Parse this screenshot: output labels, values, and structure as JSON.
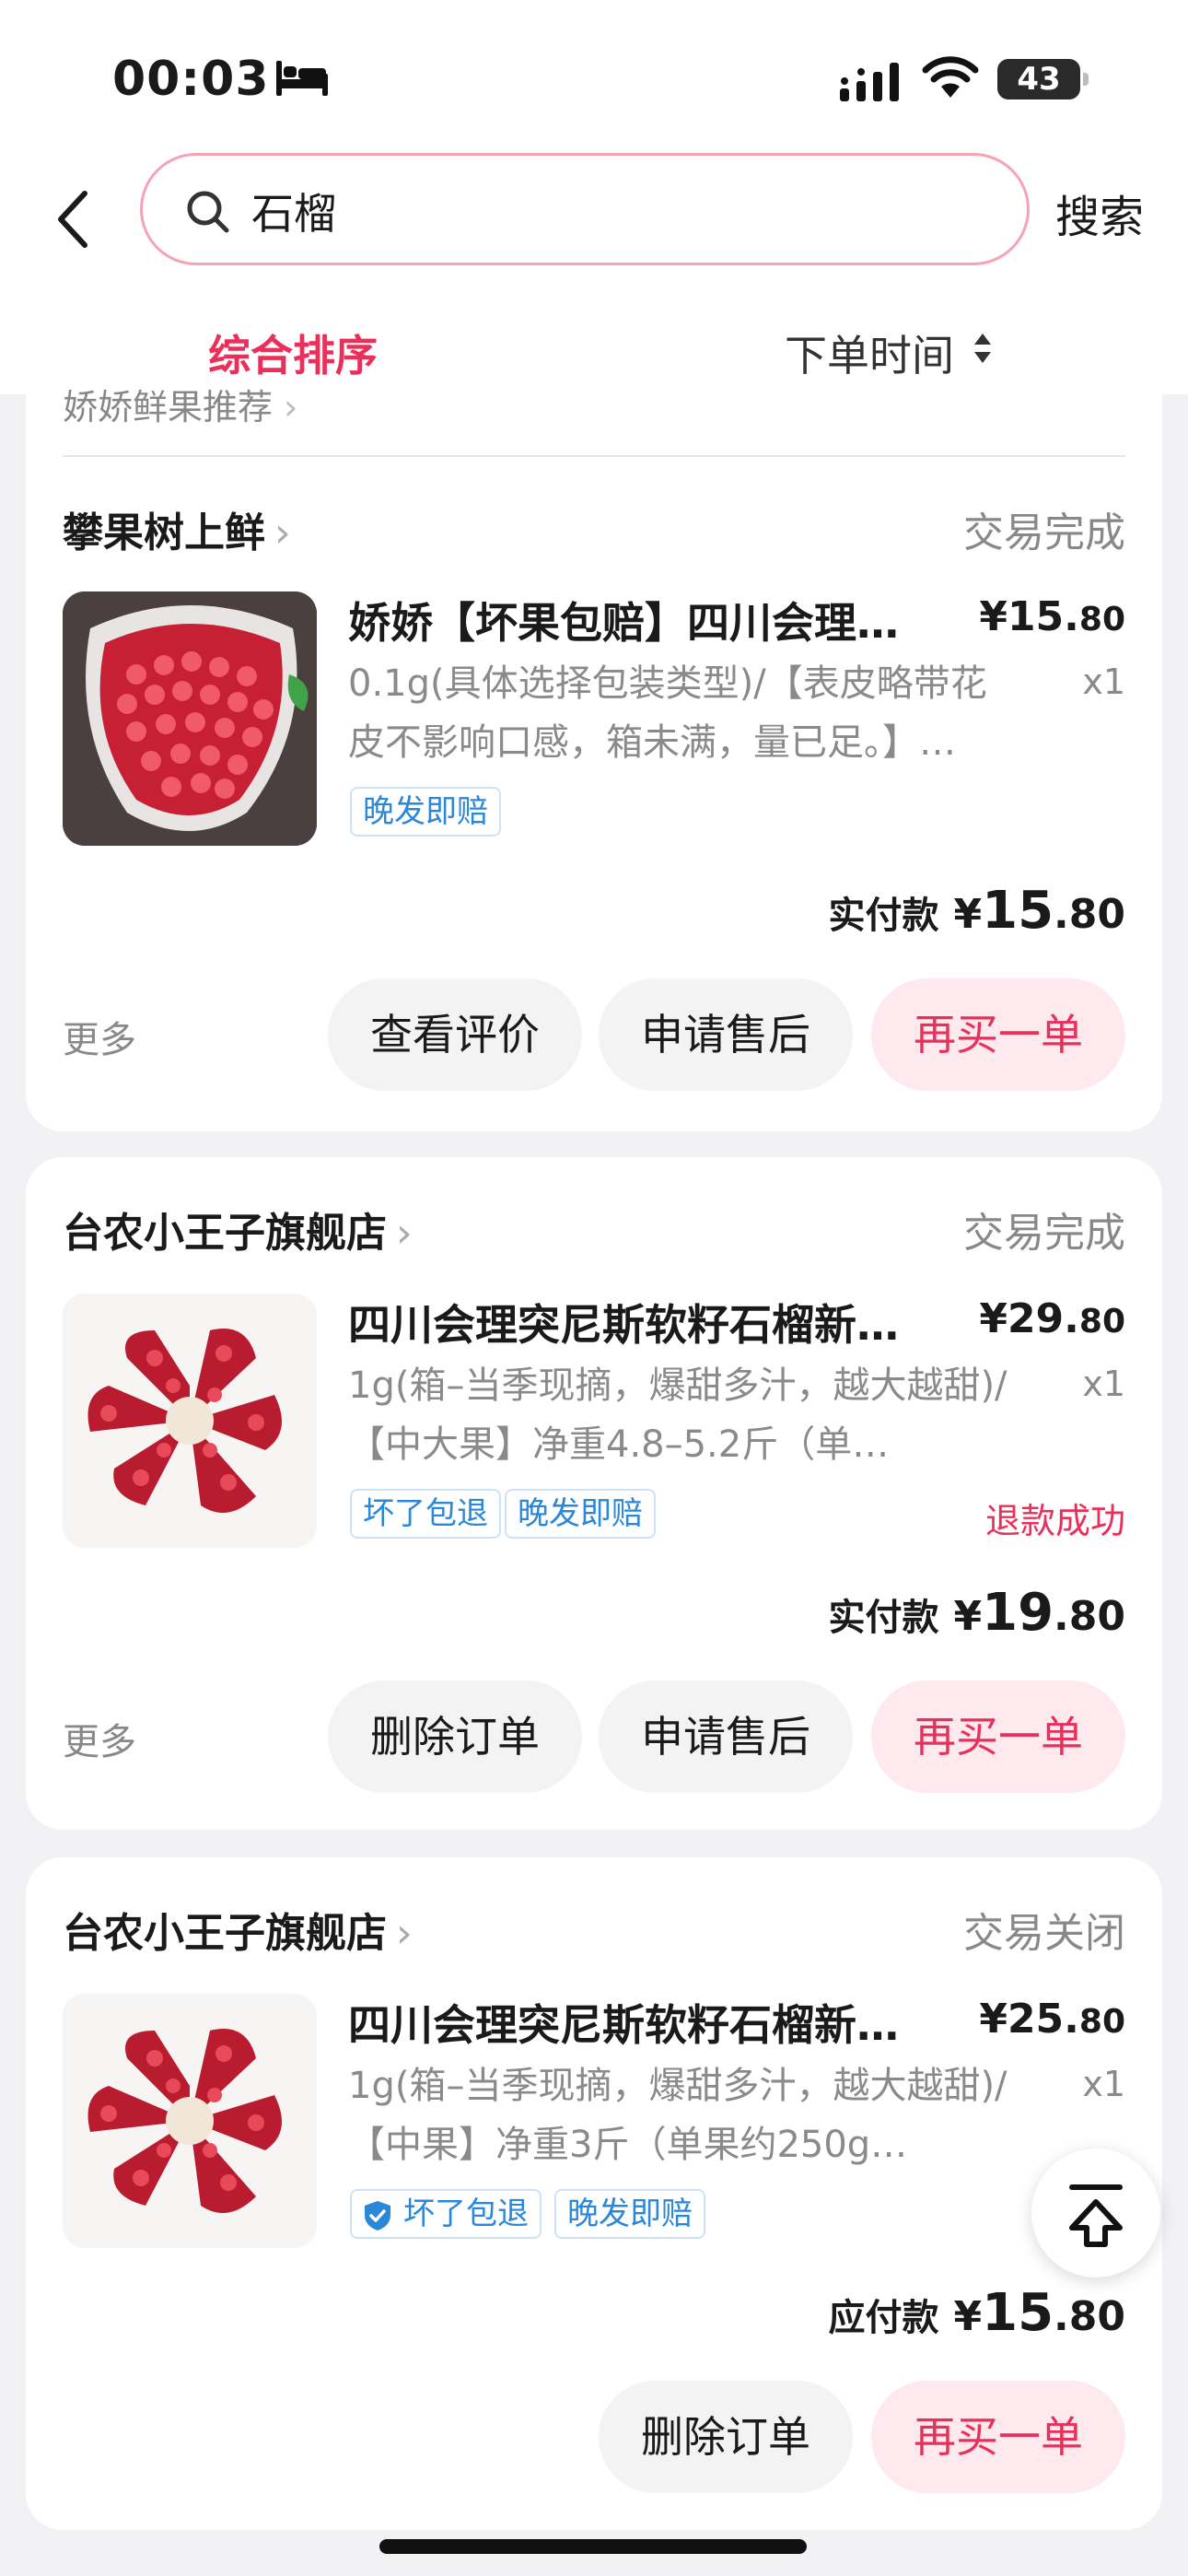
{
  "status_bar": {
    "time": "00:03",
    "battery": "43"
  },
  "search": {
    "value": "石榴",
    "button": "搜索"
  },
  "sort": {
    "primary": "综合排序",
    "secondary": "下单时间"
  },
  "previous_card": {
    "recommend_text": "娇娇鲜果推荐"
  },
  "orders": [
    {
      "shop": "攀果树上鲜",
      "status": "交易完成",
      "title": "娇娇【坏果包赔】四川会理突尼斯软籽石榴",
      "price_int": "¥15.",
      "price_dec": "80",
      "spec": "0.1g(具体选择包装类型)/【表皮略带花皮不影响口感，箱未满，量已足。】…",
      "qty": "x1",
      "tags": [
        "晚发即赔"
      ],
      "paid_label": "实付款",
      "paid_yen": "¥",
      "paid_int": "15",
      "paid_dec": ".80",
      "more": "更多",
      "buttons": [
        "查看评价",
        "申请售后",
        "再买一单"
      ]
    },
    {
      "shop": "台农小王子旗舰店",
      "status": "交易完成",
      "title": "四川会理突尼斯软籽石榴新鲜水果",
      "price_int": "¥29.",
      "price_dec": "80",
      "spec": "1g(箱–当季现摘，爆甜多汁，越大越甜)/【中大果】净重4.8–5.2斤（单…",
      "qty": "x1",
      "tags": [
        "坏了包退",
        "晚发即赔"
      ],
      "refund": "退款成功",
      "paid_label": "实付款",
      "paid_yen": "¥",
      "paid_int": "19",
      "paid_dec": ".80",
      "more": "更多",
      "buttons": [
        "删除订单",
        "申请售后",
        "再买一单"
      ]
    },
    {
      "shop": "台农小王子旗舰店",
      "status": "交易关闭",
      "title": "四川会理突尼斯软籽石榴新鲜水果",
      "price_int": "¥25.",
      "price_dec": "80",
      "spec": "1g(箱–当季现摘，爆甜多汁，越大越甜)/【中果】净重3斤（单果约250g…",
      "qty": "x1",
      "tags": [
        "坏了包退",
        "晚发即赔"
      ],
      "paid_label": "应付款",
      "paid_yen": "¥",
      "paid_int": "15",
      "paid_dec": ".80",
      "buttons": [
        "删除订单",
        "再买一单"
      ]
    }
  ],
  "colors": {
    "accent": "#e8305a",
    "tag_blue": "#2b87d8"
  },
  "icons": [
    "back-icon",
    "search-icon",
    "sort-arrows-icon",
    "back-to-top-icon",
    "sleep-bed-icon",
    "signal-icon",
    "wifi-icon",
    "battery-icon"
  ]
}
